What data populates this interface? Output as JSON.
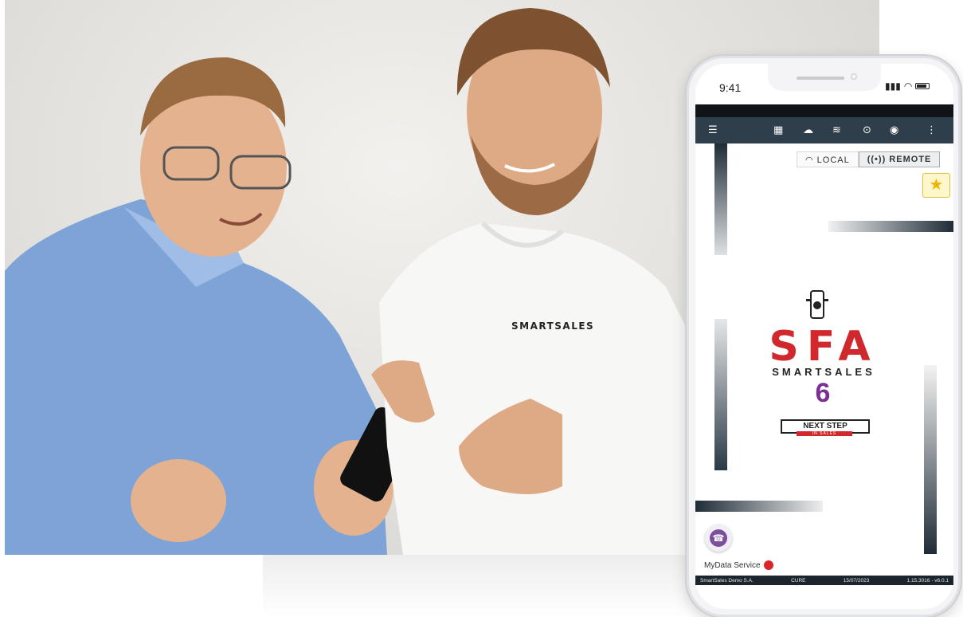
{
  "photo": {
    "shirt_logo": "SMARTSALES"
  },
  "phone": {
    "status_bar": {
      "time": "9:41"
    },
    "app_bar": {
      "icons": [
        "menu-icon",
        "grid-icon",
        "cloud-icon",
        "wifi-icon",
        "location-icon",
        "globe-icon",
        "more-icon"
      ]
    },
    "connection": {
      "local_label": "LOCAL",
      "remote_label": "REMOTE",
      "selected": "REMOTE"
    },
    "logo": {
      "brand_short": "SFA",
      "brand_name": "SMARTSALES",
      "version": "6",
      "tagline": "NEXT STEP",
      "tagline_sub": "IN SALES"
    },
    "service": {
      "label": "MyData Service",
      "status_color": "#d8262a"
    },
    "footer": {
      "company": "SmartSales Demo S.A.",
      "user": "CURE",
      "date": "15/07/2023",
      "version": "1.15.3016 - v6.0.1"
    }
  },
  "colors": {
    "appbar": "#2f3e4b",
    "accent_red": "#d0282c",
    "accent_purple": "#7a2f96"
  }
}
